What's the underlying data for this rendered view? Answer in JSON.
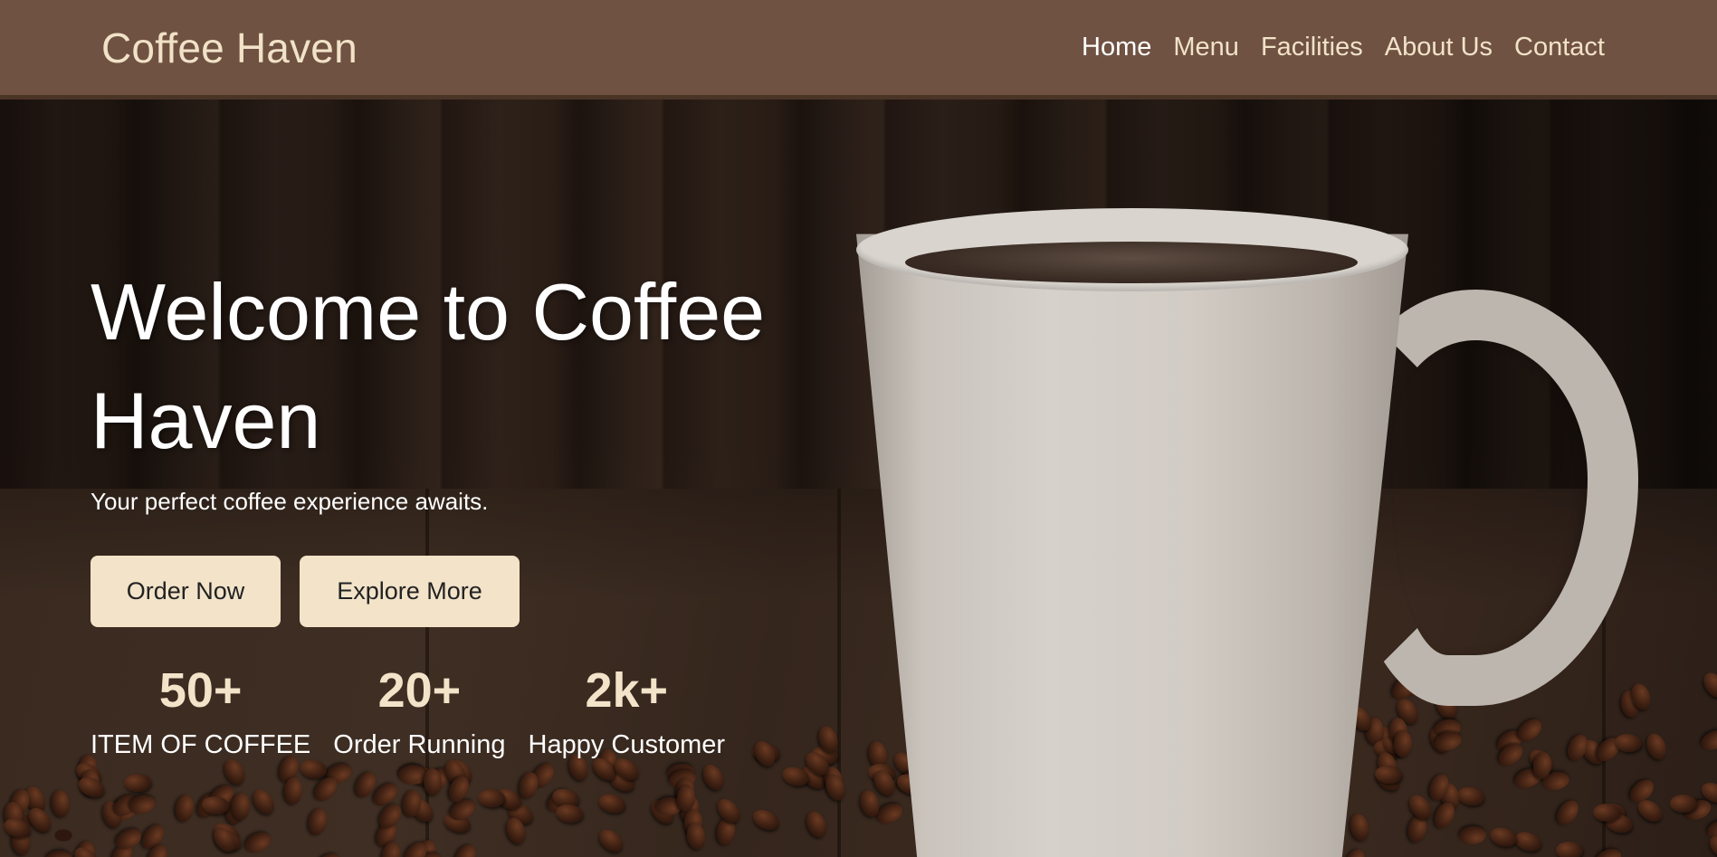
{
  "header": {
    "brand": "Coffee Haven",
    "nav": [
      {
        "label": "Home",
        "active": true
      },
      {
        "label": "Menu",
        "active": false
      },
      {
        "label": "Facilities",
        "active": false
      },
      {
        "label": "About Us",
        "active": false
      },
      {
        "label": "Contact",
        "active": false
      }
    ]
  },
  "hero": {
    "title": "Welcome to Coffee Haven",
    "subtitle": "Your perfect coffee experience awaits.",
    "buttons": {
      "order": "Order Now",
      "explore": "Explore More"
    },
    "stats": [
      {
        "value": "50+",
        "label": "ITEM OF COFFEE"
      },
      {
        "value": "20+",
        "label": "Order Running"
      },
      {
        "value": "2k+",
        "label": "Happy Customer"
      }
    ]
  },
  "colors": {
    "navbar": "#6f5242",
    "accent": "#f2e3c9",
    "text": "#ffffff"
  }
}
